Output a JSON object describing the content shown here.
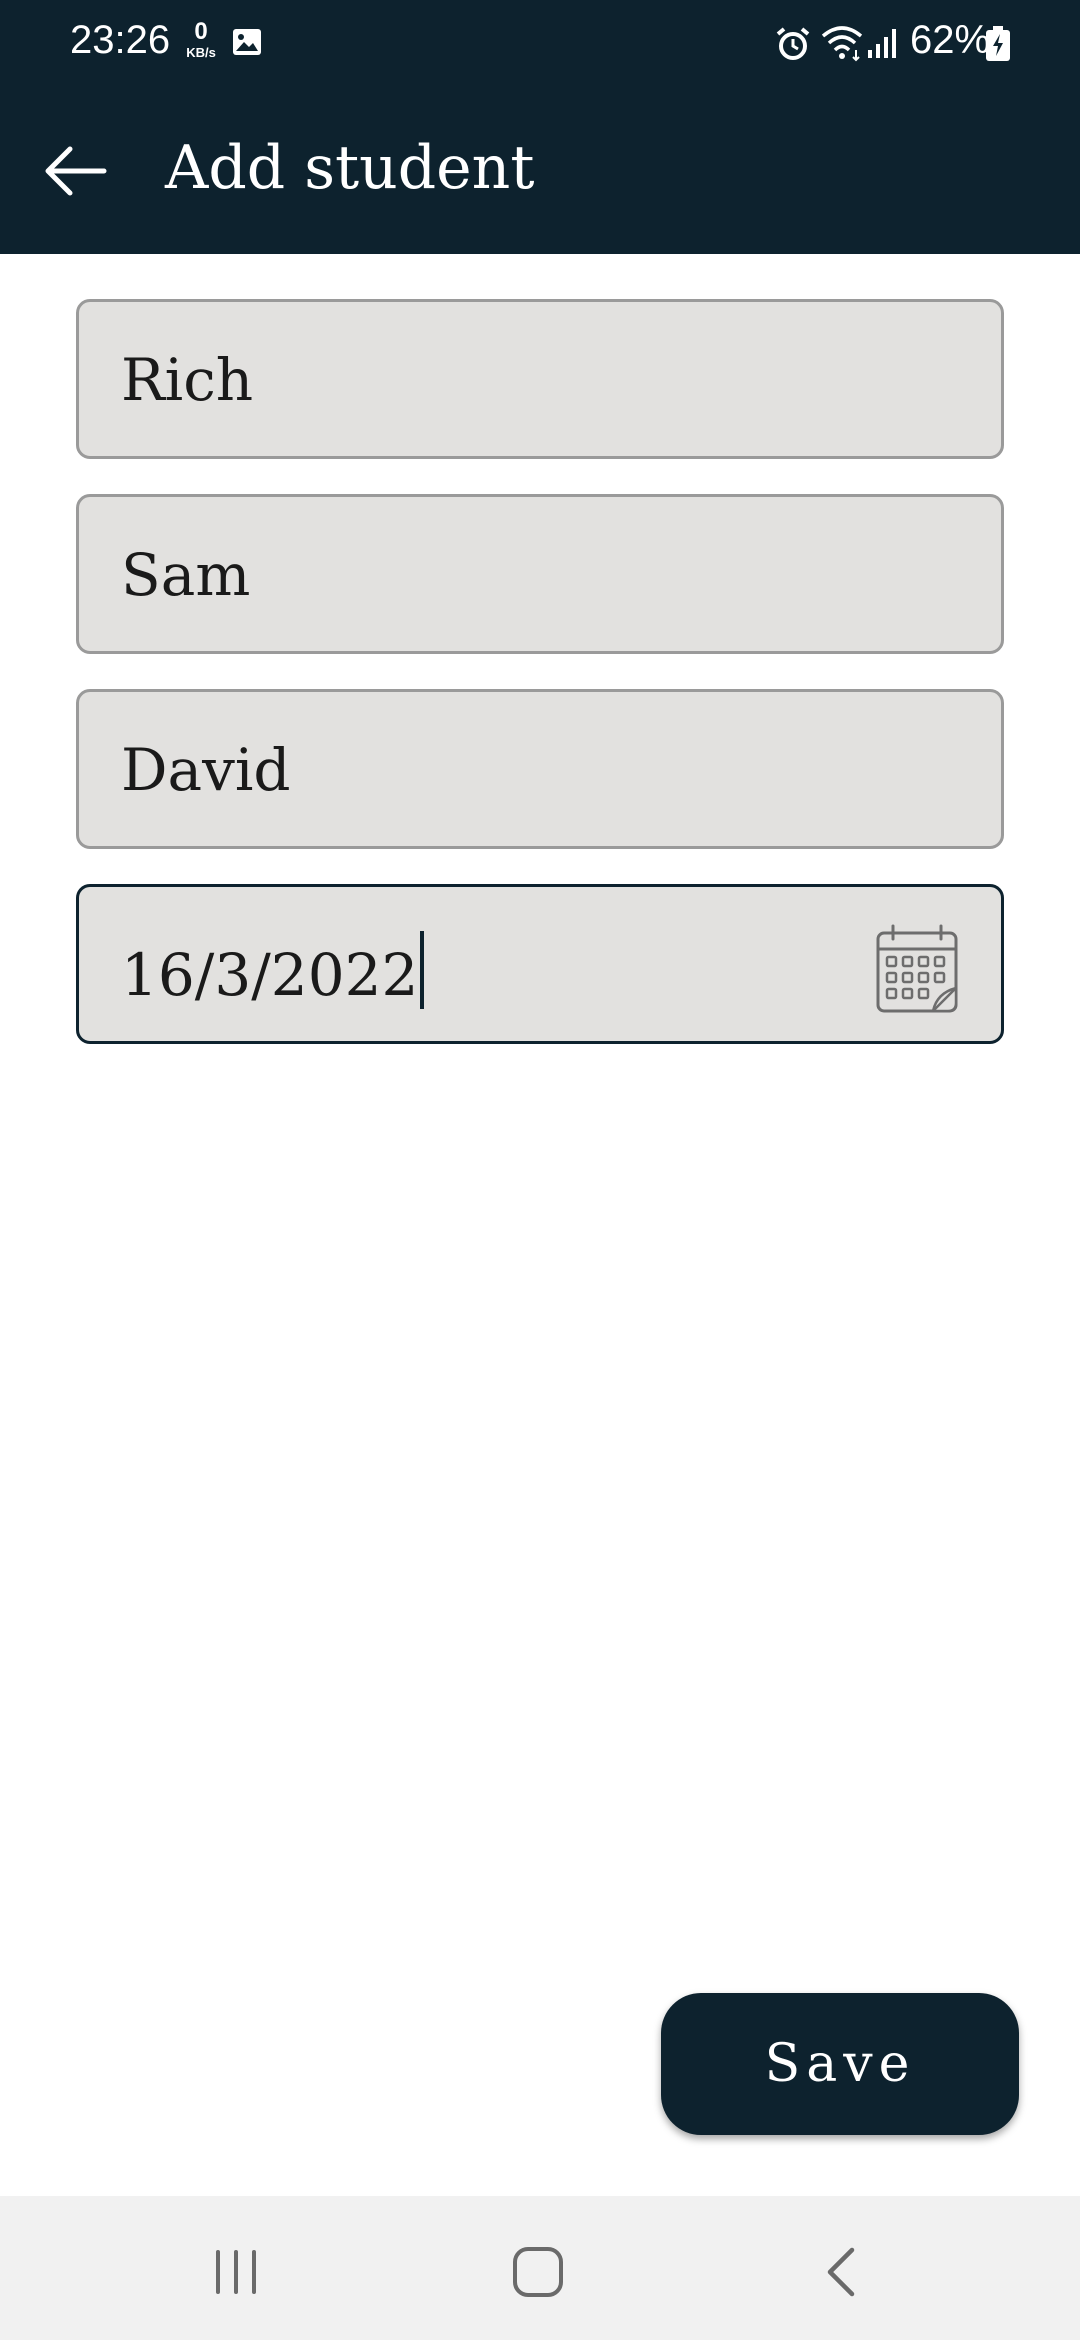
{
  "status_bar": {
    "time": "23:26",
    "net_speed_value": "0",
    "net_speed_unit": "KB/s",
    "battery_percent": "62%",
    "icons": [
      "gallery-icon",
      "alarm-icon",
      "wifi-icon",
      "signal-icon",
      "battery-charging-icon"
    ]
  },
  "app_bar": {
    "title": "Add student",
    "back_icon": "arrow-left-icon"
  },
  "form": {
    "fields": [
      {
        "name": "first-name-field",
        "value": "Rich"
      },
      {
        "name": "middle-name-field",
        "value": "Sam"
      },
      {
        "name": "last-name-field",
        "value": "David"
      },
      {
        "name": "date-field",
        "value": "16/3/2022",
        "icon": "calendar-icon"
      }
    ]
  },
  "actions": {
    "save_label": "Save"
  },
  "nav_bar": {
    "icons": [
      "recents-icon",
      "home-icon",
      "back-icon"
    ]
  },
  "colors": {
    "primary": "#0d222e",
    "field_bg": "#e2e1df",
    "field_border": "#9a9a9a",
    "nav_bg": "#f1f1f1"
  }
}
